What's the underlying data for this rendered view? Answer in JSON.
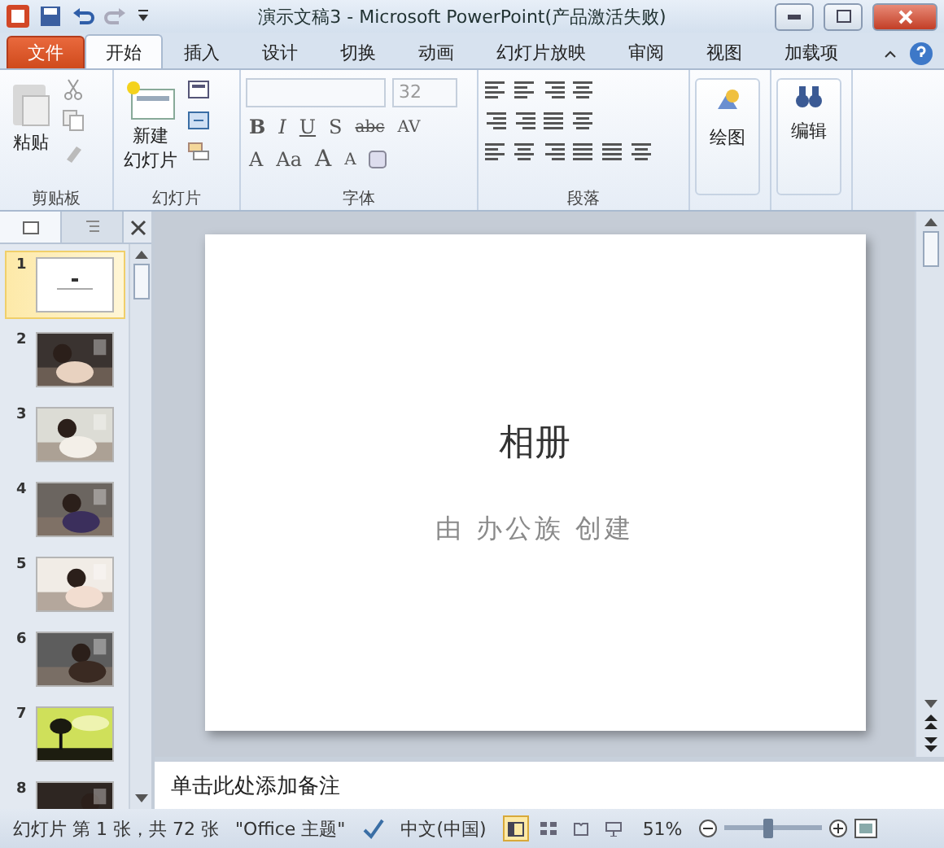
{
  "window": {
    "title": "演示文稿3  -  Microsoft PowerPoint(产品激活失败)"
  },
  "file_tab": "文件",
  "tabs": [
    {
      "label": "开始",
      "selected": true
    },
    {
      "label": "插入",
      "selected": false
    },
    {
      "label": "设计",
      "selected": false
    },
    {
      "label": "切换",
      "selected": false
    },
    {
      "label": "动画",
      "selected": false
    },
    {
      "label": "幻灯片放映",
      "selected": false
    },
    {
      "label": "审阅",
      "selected": false
    },
    {
      "label": "视图",
      "selected": false
    },
    {
      "label": "加载项",
      "selected": false
    }
  ],
  "ribbon": {
    "clipboard": {
      "label": "剪贴板",
      "paste": "粘贴"
    },
    "slides": {
      "label": "幻灯片",
      "new_slide": [
        "新建",
        "幻灯片"
      ]
    },
    "font": {
      "label": "字体",
      "size": "32",
      "format_buttons": [
        "B",
        "I",
        "U",
        "S",
        "abc",
        "AV"
      ],
      "size_buttons": [
        "A",
        "Aa",
        "A",
        "A"
      ]
    },
    "paragraph": {
      "label": "段落"
    },
    "drawing": {
      "label": "绘图"
    },
    "editing": {
      "label": "编辑"
    }
  },
  "slides_panel": {
    "slides": [
      {
        "number": "1",
        "selected": true,
        "kind": "title"
      },
      {
        "number": "2",
        "selected": false,
        "kind": "picture"
      },
      {
        "number": "3",
        "selected": false,
        "kind": "picture"
      },
      {
        "number": "4",
        "selected": false,
        "kind": "picture"
      },
      {
        "number": "5",
        "selected": false,
        "kind": "picture"
      },
      {
        "number": "6",
        "selected": false,
        "kind": "picture"
      },
      {
        "number": "7",
        "selected": false,
        "kind": "picture"
      },
      {
        "number": "8",
        "selected": false,
        "kind": "picture"
      }
    ]
  },
  "slide": {
    "title": "相册",
    "subtitle": "由 办公族 创建"
  },
  "notes": {
    "placeholder": "单击此处添加备注"
  },
  "status_bar": {
    "slide_info": "幻灯片 第 1 张，共 72 张",
    "theme": "\"Office 主题\"",
    "language": "中文(中国)",
    "views": [
      {
        "kind": "normal",
        "selected": true
      },
      {
        "kind": "sorter",
        "selected": false
      },
      {
        "kind": "reading",
        "selected": false
      },
      {
        "kind": "slideshow",
        "selected": false
      }
    ],
    "zoom": "51%",
    "zoom_slider": {
      "level": 0.45
    }
  }
}
